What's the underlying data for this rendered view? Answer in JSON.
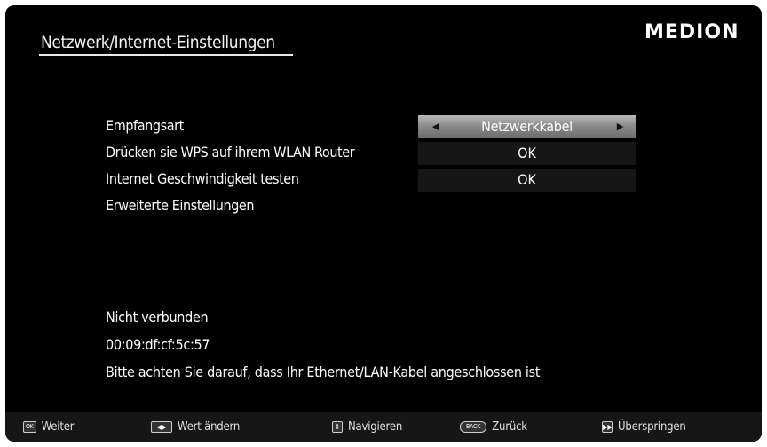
{
  "header": {
    "title": "Netzwerk/Internet-Einstellungen",
    "brand": "MEDION"
  },
  "settings": {
    "empfangsart_label": "Empfangsart",
    "empfangsart_value": "Netzwerkkabel",
    "wps_label": "Drücken sie WPS auf ihrem WLAN Router",
    "wps_value": "OK",
    "speed_label": "Internet Geschwindigkeit testen",
    "speed_value": "OK",
    "advanced_label": "Erweiterte Einstellungen"
  },
  "status": {
    "connection": "Nicht verbunden",
    "mac": "00:09:df:cf:5c:57",
    "message": "Bitte achten Sie darauf, dass Ihr Ethernet/LAN-Kabel angeschlossen ist"
  },
  "footer": {
    "ok_key": "OK",
    "ok_label": "Weiter",
    "change_label": "Wert ändern",
    "navigate_label": "Navigieren",
    "back_key": "BACK",
    "back_label": "Zurück",
    "skip_label": "Überspringen"
  },
  "icons": [
    "ok-key-icon",
    "left-right-arrows-icon",
    "up-down-arrows-icon",
    "back-key-icon",
    "fast-forward-icon",
    "arrow-left-icon",
    "arrow-right-icon"
  ],
  "colors": {
    "background": "#000000",
    "selected_bar": "#9a9a9a",
    "value_box": "#161616",
    "text": "#ffffff"
  }
}
